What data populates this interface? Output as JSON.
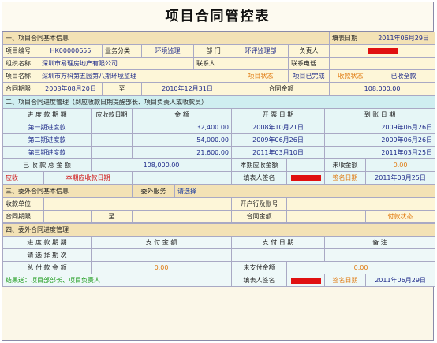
{
  "title": "项目合同管控表",
  "s1": {
    "heading": "一、项目合同基本信息",
    "fill_date_label": "填表日期",
    "fill_date": "2011年06月29日",
    "proj_no_label": "项目编号",
    "proj_no": "HK00000655",
    "biz_type_label": "业务分类",
    "biz_type": "环境监理",
    "dept_label": "部    门",
    "dept": "环评监理部",
    "owner_label": "负责人",
    "org_label": "组织名称",
    "org": "深圳市易理房地产有限公司",
    "contact_label": "联系人",
    "phone_label": "联系电话",
    "proj_name_label": "项目名称",
    "proj_name": "深圳市万科第五园第八期环境监理",
    "proj_status_label": "项目状态",
    "proj_status": "项目已完成",
    "collect_status_label": "收款状态",
    "collect_status": "已收全款",
    "period_label": "合同期限",
    "period_start": "2008年08月20日",
    "period_to": "至",
    "period_end": "2010年12月31日",
    "amount_label": "合同金额",
    "amount": "108,000.00"
  },
  "s2": {
    "heading": "二、项目合同进度管理（到应收款日期提醒部长、项目负责人或收款员）",
    "col_term": "进 度 款 期 期",
    "col_due": "应收款日期",
    "col_amount": "金    额",
    "col_invoice": "开 票 日 期",
    "col_arrival": "到 账 日 期",
    "rows": [
      {
        "term": "第一期进度款",
        "amount": "32,400.00",
        "invoice": "2008年10月21日",
        "arrival": "2009年06月26日"
      },
      {
        "term": "第二期进度款",
        "amount": "54,000.00",
        "invoice": "2009年06月26日",
        "arrival": "2009年06月26日"
      },
      {
        "term": "第三期进度款",
        "amount": "21,600.00",
        "invoice": "2011年03月10日",
        "arrival": "2011年03月25日"
      }
    ],
    "received_total_label": "已 收 款 总 金 额",
    "received_total": "108,000.00",
    "period_receivable_label": "本期应收金额",
    "uncollected_label": "未收金额",
    "uncollected": "0.00",
    "receivable_label": "应收",
    "period_due_date_label": "本期应收款日期",
    "filler_sign_label": "填表人签名",
    "sign_date_label": "签名日期",
    "sign_date": "2011年03月25日"
  },
  "s3": {
    "heading": "三、委外合同基本信息",
    "service_label": "委外服务",
    "service_value": "请选择",
    "payee_label": "收款单位",
    "bank_label": "开户行及账号",
    "period_label": "合同期限",
    "period_to": "至",
    "amount_label": "合同金额",
    "pay_status_label": "付款状态"
  },
  "s4": {
    "heading": "四、委外合同进度管理",
    "col_term": "进 度 款 期 期",
    "col_pay_amount": "支 付 金 额",
    "col_pay_date": "支 付 日 期",
    "col_note": "备    注",
    "select_term": "请 选 择 期 次",
    "total_paid_label": "总 付 款 金 额",
    "total_paid": "0.00",
    "unpaid_label": "未支付金额",
    "unpaid": "0.00",
    "remind": "结果送：项目部部长、项目负责人",
    "filler_sign_label": "填表人签名",
    "sign_date_label": "签名日期",
    "sign_date": "2011年06月29日"
  },
  "colors": {
    "accent_red": "#e01010",
    "orange": "#e07a10",
    "section1_bg": "#f3e2b5",
    "section2_bg": "#cfeef0"
  }
}
